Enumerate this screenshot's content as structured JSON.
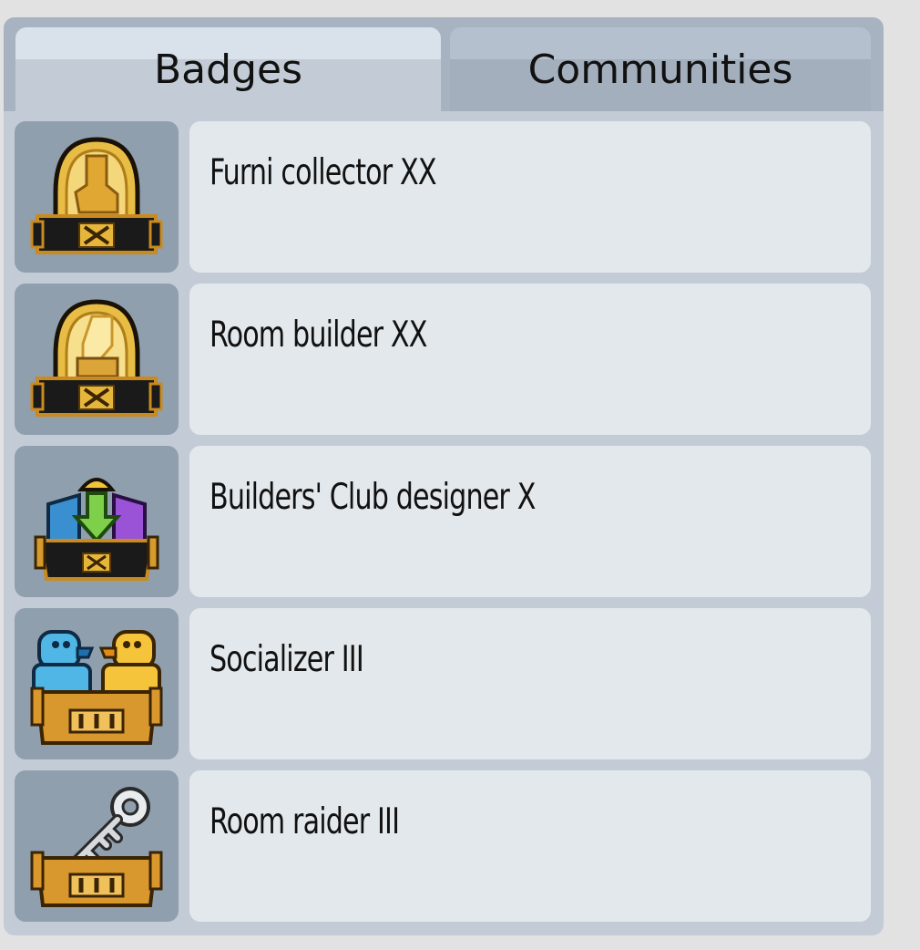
{
  "tabs": {
    "badges": "Badges",
    "communities": "Communities"
  },
  "badges": [
    {
      "name": "Furni collector XX",
      "icon": "furni-collector-badge-icon"
    },
    {
      "name": "Room builder XX",
      "icon": "room-builder-badge-icon"
    },
    {
      "name": "Builders' Club designer X",
      "icon": "builders-club-badge-icon"
    },
    {
      "name": "Socializer III",
      "icon": "socializer-badge-icon"
    },
    {
      "name": "Room raider III",
      "icon": "room-raider-badge-icon"
    }
  ],
  "colors": {
    "background": "#e2e2e2",
    "panel": "#c3ccd6",
    "tab_bar": "#a7b3c0",
    "badge_box": "#8f9fae",
    "row_box": "#e3e8ec",
    "gold": "#e6b63a",
    "bronze": "#c98a2e"
  }
}
